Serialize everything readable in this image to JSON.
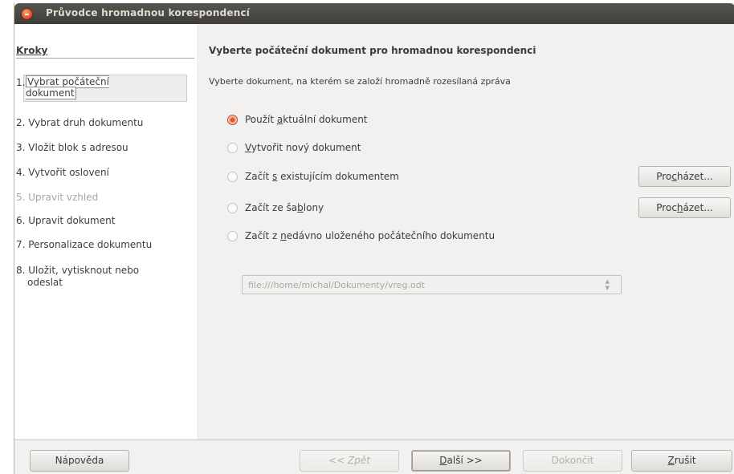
{
  "window": {
    "title": "Průvodce hromadnou korespondencí"
  },
  "sidebar": {
    "header": "Kroky",
    "current_step_number": "1.",
    "current_step_label": "Vybrat počáteční dokument",
    "steps": [
      {
        "label": "2. Vybrat druh dokumentu",
        "enabled": true
      },
      {
        "label": "3. Vložit blok s adresou",
        "enabled": true
      },
      {
        "label": "4. Vytvořit oslovení",
        "enabled": true
      },
      {
        "label": "5. Upravit vzhled",
        "enabled": false
      },
      {
        "label": "6. Upravit dokument",
        "enabled": true
      },
      {
        "label": "7. Personalizace dokumentu",
        "enabled": true
      },
      {
        "label": "8. Uložit, vytisknout nebo odeslat",
        "enabled": true
      }
    ]
  },
  "main": {
    "title": "Vyberte počáteční dokument pro hromadnou korespondenci",
    "description": "Vyberte dokument, na kterém se založí hromadně rozesílaná zpráva",
    "options": [
      {
        "pre": "Použít ",
        "mnemonic": "a",
        "post": "ktuální dokument",
        "checked": true
      },
      {
        "pre": "",
        "mnemonic": "V",
        "post": "ytvořit nový dokument",
        "checked": false
      },
      {
        "pre": "Začít ",
        "mnemonic": "s",
        "post": " existujícím dokumentem",
        "checked": false
      },
      {
        "pre": "Začít ze ša",
        "mnemonic": "b",
        "post": "lony",
        "checked": false
      },
      {
        "pre": "Začít z ",
        "mnemonic": "n",
        "post": "edávno uloženého počátečního dokumentu",
        "checked": false
      }
    ],
    "browse1": {
      "pre": "Pro",
      "mnemonic": "c",
      "post": "házet..."
    },
    "browse2": {
      "pre": "Proc",
      "mnemonic": "h",
      "post": "ázet..."
    },
    "recent_path": "file:///home/michal/Dokumenty/vreg.odt"
  },
  "footer": {
    "help": "Nápověda",
    "back": "<< Zpět",
    "next": {
      "mnemonic": "D",
      "post": "alší >>"
    },
    "finish": "Dokončit",
    "cancel": {
      "mnemonic": "Z",
      "post": "rušit"
    }
  },
  "icons": {
    "close": "close-icon",
    "cursor": "mouse-pointer-icon"
  },
  "colors": {
    "accent": "#e5532d",
    "titlebar": "#3e3d39"
  }
}
